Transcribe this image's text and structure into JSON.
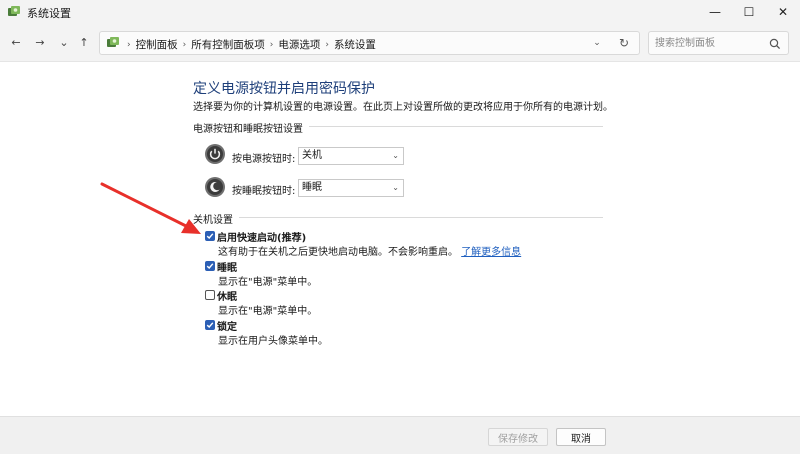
{
  "window": {
    "title": "系统设置",
    "minimize_glyph": "—",
    "maximize_glyph": "☐",
    "close_glyph": "✕"
  },
  "address_bar": {
    "breadcrumbs": [
      "控制面板",
      "所有控制面板项",
      "电源选项",
      "系统设置"
    ],
    "separator": "›",
    "dropdown_glyph": "⌄",
    "refresh_glyph": "↻"
  },
  "search": {
    "placeholder": "搜索控制面板"
  },
  "nav": {
    "back": "←",
    "forward": "→",
    "recent": "⌄",
    "up": "↑"
  },
  "page": {
    "title": "定义电源按钮并启用密码保护",
    "description": "选择要为你的计算机设置的电源设置。在此页上对设置所做的更改将应用于你所有的电源计划。"
  },
  "power_section": {
    "heading": "电源按钮和睡眠按钮设置",
    "rows": [
      {
        "label": "按电源按钮时:",
        "value": "关机",
        "icon": "power-button-icon"
      },
      {
        "label": "按睡眠按钮时:",
        "value": "睡眠",
        "icon": "sleep-button-icon"
      }
    ]
  },
  "shutdown_section": {
    "heading": "关机设置",
    "options": [
      {
        "label": "启用快速启动(推荐)",
        "checked": true,
        "description": "这有助于在关机之后更快地启动电脑。不会影响重启。",
        "link": "了解更多信息"
      },
      {
        "label": "睡眠",
        "checked": true,
        "description": "显示在\"电源\"菜单中。"
      },
      {
        "label": "休眠",
        "checked": false,
        "description": "显示在\"电源\"菜单中。"
      },
      {
        "label": "锁定",
        "checked": true,
        "description": "显示在用户头像菜单中。"
      }
    ]
  },
  "footer": {
    "save_label": "保存修改",
    "cancel_label": "取消"
  },
  "colors": {
    "accent": "#2c5fb5",
    "title": "#1e3f7a",
    "link": "#1f5fbf",
    "annotation_arrow": "#e8302a"
  }
}
